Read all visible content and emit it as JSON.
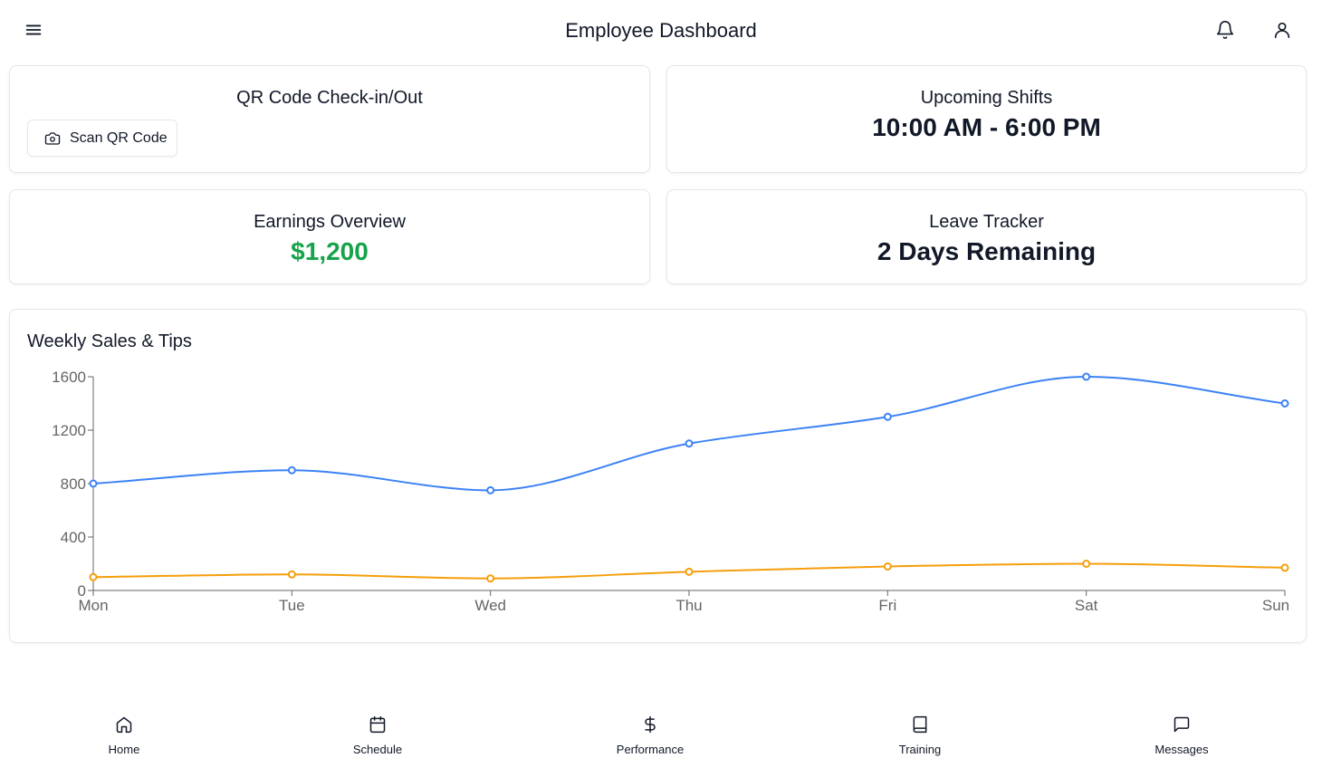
{
  "header": {
    "title": "Employee Dashboard",
    "menu_icon": "menu-icon",
    "notification_icon": "bell-icon",
    "profile_icon": "user-icon"
  },
  "qr_card": {
    "title": "QR Code Check-in/Out",
    "button_label": "Scan QR Code",
    "button_icon": "camera-icon"
  },
  "shifts_card": {
    "title": "Upcoming Shifts",
    "value": "10:00 AM - 6:00 PM"
  },
  "earnings_card": {
    "title": "Earnings Overview",
    "value": "$1,200",
    "value_color": "#16a34a"
  },
  "leave_card": {
    "title": "Leave Tracker",
    "value": "2 Days Remaining"
  },
  "chart_card": {
    "title": "Weekly Sales & Tips"
  },
  "chart_data": {
    "type": "line",
    "title": "Weekly Sales & Tips",
    "categories": [
      "Mon",
      "Tue",
      "Wed",
      "Thu",
      "Fri",
      "Sat",
      "Sun"
    ],
    "series": [
      {
        "color": "#3b82f6",
        "values": [
          800,
          900,
          750,
          1100,
          1300,
          1600,
          1400
        ]
      },
      {
        "color": "#f59e0b",
        "values": [
          100,
          120,
          90,
          140,
          180,
          200,
          170
        ]
      }
    ],
    "yticks": [
      0,
      400,
      800,
      1200,
      1600
    ],
    "ylim": [
      0,
      1600
    ],
    "grid": false,
    "smooth": true,
    "axis_color": "#666666"
  },
  "bottom_nav": {
    "items": [
      {
        "label": "Home",
        "icon": "home-icon"
      },
      {
        "label": "Schedule",
        "icon": "calendar-icon"
      },
      {
        "label": "Performance",
        "icon": "dollar-icon"
      },
      {
        "label": "Training",
        "icon": "book-icon"
      },
      {
        "label": "Messages",
        "icon": "message-icon"
      }
    ]
  }
}
